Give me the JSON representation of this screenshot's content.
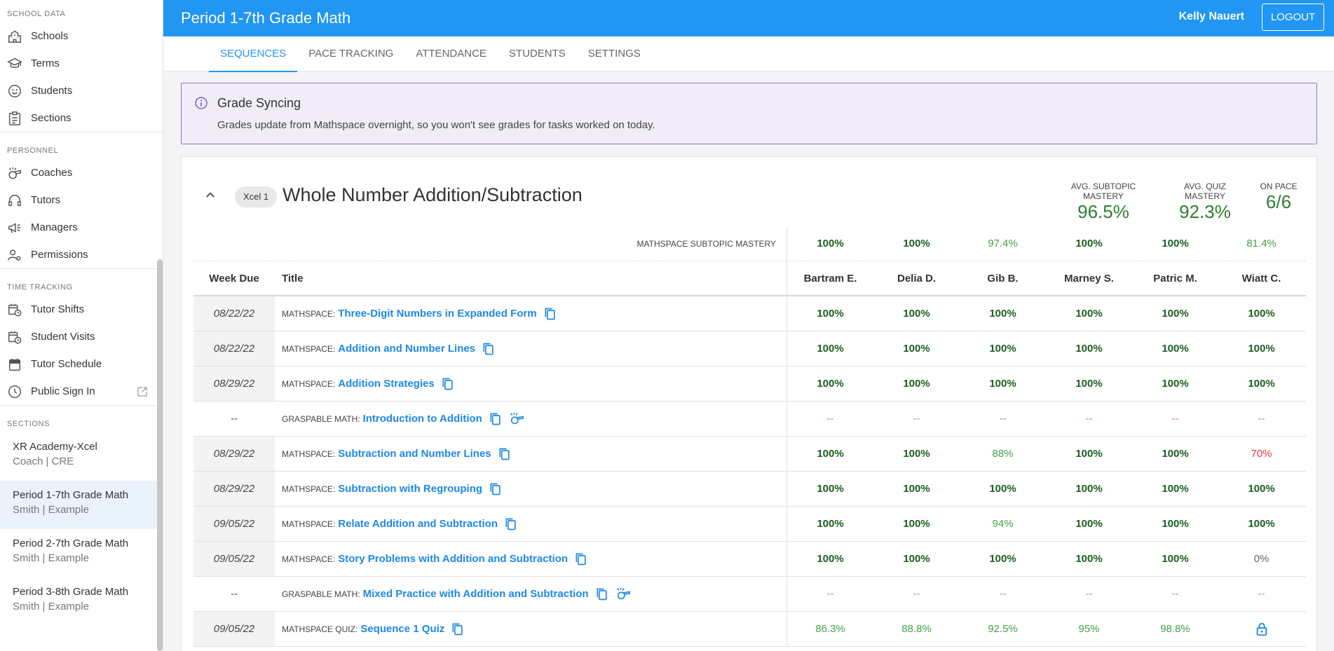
{
  "sidebar": {
    "groups": [
      {
        "heading": "School Data",
        "items": [
          {
            "label": "Schools",
            "icon": "school-icon"
          },
          {
            "label": "Terms",
            "icon": "graduation-cap-icon"
          },
          {
            "label": "Students",
            "icon": "smiley-icon"
          },
          {
            "label": "Sections",
            "icon": "clipboard-icon"
          }
        ]
      },
      {
        "heading": "Personnel",
        "items": [
          {
            "label": "Coaches",
            "icon": "whistle-icon"
          },
          {
            "label": "Tutors",
            "icon": "headset-icon"
          },
          {
            "label": "Managers",
            "icon": "megaphone-icon"
          },
          {
            "label": "Permissions",
            "icon": "user-gear-icon"
          }
        ]
      },
      {
        "heading": "Time Tracking",
        "items": [
          {
            "label": "Tutor Shifts",
            "icon": "calendar-clock-icon"
          },
          {
            "label": "Student Visits",
            "icon": "calendar-clock-icon"
          },
          {
            "label": "Tutor Schedule",
            "icon": "calendar-icon"
          },
          {
            "label": "Public Sign In",
            "icon": "clock-icon"
          }
        ]
      }
    ],
    "sections_heading": "Sections",
    "sections": [
      {
        "name": "XR Academy-Xcel",
        "sub": "Coach | CRE",
        "active": false
      },
      {
        "name": "Period 1-7th Grade Math",
        "sub": "Smith | Example",
        "active": true
      },
      {
        "name": "Period 2-7th Grade Math",
        "sub": "Smith | Example",
        "active": false
      },
      {
        "name": "Period 3-8th Grade Math",
        "sub": "Smith | Example",
        "active": false
      }
    ]
  },
  "header": {
    "title": "Period 1-7th Grade Math",
    "user": "Kelly Nauert",
    "logout": "LOGOUT"
  },
  "tabs": [
    "Sequences",
    "Pace Tracking",
    "Attendance",
    "Students",
    "Settings"
  ],
  "active_tab": 0,
  "alert": {
    "title": "Grade Syncing",
    "body": "Grades update from Mathspace overnight, so you won't see grades for tasks worked on today."
  },
  "sequence": {
    "chip": "Xcel 1",
    "title": "Whole Number Addition/Subtraction",
    "stats": [
      {
        "label": "Avg. Subtopic Mastery",
        "value": "96.5%"
      },
      {
        "label": "Avg. Quiz Mastery",
        "value": "92.3%"
      },
      {
        "label": "On Pace",
        "value": "6/6"
      }
    ],
    "mastery_label": "Mathspace Subtopic Mastery",
    "mastery_values": [
      "100%",
      "100%",
      "97.4%",
      "100%",
      "100%",
      "81.4%"
    ],
    "columns": {
      "week": "Week Due",
      "title": "Title"
    },
    "students": [
      "Bartram E.",
      "Delia D.",
      "Gib B.",
      "Marney S.",
      "Patric M.",
      "Wiatt C."
    ],
    "rows": [
      {
        "week": "08/22/22",
        "source": "MATHSPACE:",
        "title": "Three-Digit Numbers in Expanded Form",
        "graspable": false,
        "values": [
          "100%",
          "100%",
          "100%",
          "100%",
          "100%",
          "100%"
        ]
      },
      {
        "week": "08/22/22",
        "source": "MATHSPACE:",
        "title": "Addition and Number Lines",
        "graspable": false,
        "values": [
          "100%",
          "100%",
          "100%",
          "100%",
          "100%",
          "100%"
        ]
      },
      {
        "week": "08/29/22",
        "source": "MATHSPACE:",
        "title": "Addition Strategies",
        "graspable": false,
        "values": [
          "100%",
          "100%",
          "100%",
          "100%",
          "100%",
          "100%"
        ]
      },
      {
        "week": "--",
        "source": "GRASPABLE MATH:",
        "title": "Introduction to Addition",
        "graspable": true,
        "values": [
          "--",
          "--",
          "--",
          "--",
          "--",
          "--"
        ]
      },
      {
        "week": "08/29/22",
        "source": "MATHSPACE:",
        "title": "Subtraction and Number Lines",
        "graspable": false,
        "values": [
          "100%",
          "100%",
          "88%",
          "100%",
          "100%",
          "70%"
        ]
      },
      {
        "week": "08/29/22",
        "source": "MATHSPACE:",
        "title": "Subtraction with Regrouping",
        "graspable": false,
        "values": [
          "100%",
          "100%",
          "100%",
          "100%",
          "100%",
          "100%"
        ]
      },
      {
        "week": "09/05/22",
        "source": "MATHSPACE:",
        "title": "Relate Addition and Subtraction",
        "graspable": false,
        "values": [
          "100%",
          "100%",
          "94%",
          "100%",
          "100%",
          "100%"
        ]
      },
      {
        "week": "09/05/22",
        "source": "MATHSPACE:",
        "title": "Story Problems with Addition and Subtraction",
        "graspable": false,
        "values": [
          "100%",
          "100%",
          "100%",
          "100%",
          "100%",
          "0%"
        ]
      },
      {
        "week": "--",
        "source": "GRASPABLE MATH:",
        "title": "Mixed Practice with Addition and Subtraction",
        "graspable": true,
        "values": [
          "--",
          "--",
          "--",
          "--",
          "--",
          "--"
        ]
      },
      {
        "week": "09/05/22",
        "source": "MATHSPACE QUIZ:",
        "title": "Sequence 1 Quiz",
        "graspable": false,
        "values": [
          "86.3%",
          "88.8%",
          "92.5%",
          "95%",
          "98.8%",
          "locked"
        ]
      }
    ]
  },
  "colors": {
    "primary": "#2196f3",
    "mastery_full": "#1b5e20",
    "mastery_mid": "#43a047",
    "mastery_low": "#e53935",
    "alert_bg": "#f1edf8",
    "alert_border": "#9575cd"
  }
}
